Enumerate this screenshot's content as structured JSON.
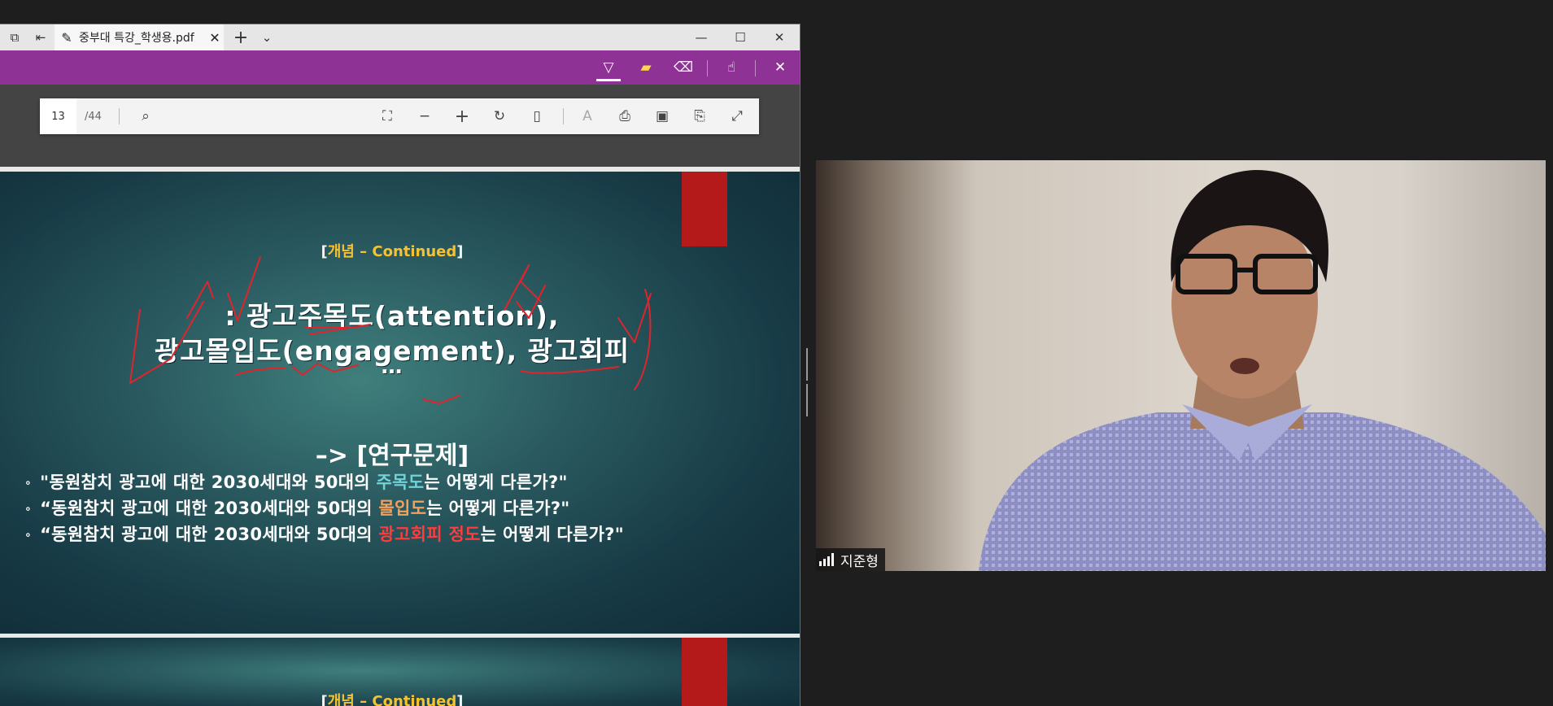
{
  "window": {
    "tab_title": "중부대 특강_학생용.pdf",
    "icons": [
      "tab-actions-icon",
      "back-tab-icon",
      "pen-icon",
      "close-icon",
      "new-tab-icon",
      "chevron-down-icon",
      "minimize-icon",
      "maximize-icon",
      "close-icon"
    ]
  },
  "ink_toolbar": {
    "icons": [
      "draw-icon",
      "highlight-icon",
      "eraser-icon",
      "touch-writing-icon",
      "close-icon"
    ],
    "accent_color": "#8f3295"
  },
  "pdf_toolbar": {
    "current_page": "13",
    "total_pages": "/44",
    "icons": [
      "search-icon",
      "fit-page-icon",
      "zoom-out-icon",
      "zoom-in-icon",
      "rotate-icon",
      "page-view-icon",
      "read-aloud-icon",
      "print-icon",
      "save-icon",
      "save-as-icon",
      "fullscreen-icon"
    ]
  },
  "slide": {
    "concept_prefix": "[",
    "concept_word": "개념 – Continued",
    "concept_suffix": "]",
    "line1": ": 광고주목도(attention),",
    "line2": "광고몰입도(engagement), 광고회피",
    "line3": "…",
    "research_question_header": "–> [연구문제]",
    "bullets": [
      {
        "dot": "∘",
        "pre": "\"동원참치 광고에 대한 2030세대와 50대의 ",
        "hl": "주목도",
        "post": "는 어떻게 다른가?\""
      },
      {
        "dot": "∘",
        "pre": "“동원참치 광고에 대한 2030세대와 50대의 ",
        "hl": "몰입도",
        "post": "는 어떻게 다른가?\""
      },
      {
        "dot": "∘",
        "pre": "“동원참치 광고에 대한 2030세대와 50대의 ",
        "hl": "광고회피 정도",
        "post": "는 어떻게 다른가?\""
      }
    ],
    "highlight_colors": [
      "#6fd3d8",
      "#f2a05d",
      "#ff3b3b"
    ]
  },
  "next_slide": {
    "concept_prefix": "[",
    "concept_word": "개념 – Continued",
    "concept_suffix": "]"
  },
  "video": {
    "participant_name": "지준형",
    "signal_icon": "signal-bars-icon"
  }
}
